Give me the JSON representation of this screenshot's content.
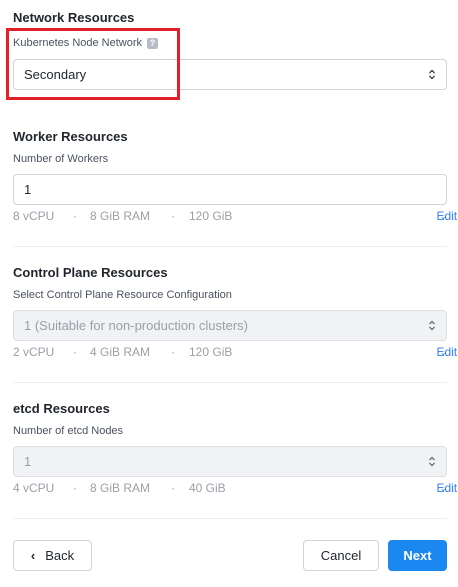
{
  "network": {
    "title": "Network Resources",
    "label": "Kubernetes Node Network",
    "help": "?",
    "value": "Secondary"
  },
  "worker": {
    "title": "Worker Resources",
    "label": "Number of Workers",
    "value": "1",
    "vcpu": "8 vCPU",
    "ram": "8 GiB RAM",
    "disk": "120 GiB",
    "edit": "Edit"
  },
  "control_plane": {
    "title": "Control Plane Resources",
    "label": "Select Control Plane Resource Configuration",
    "value": "1 (Suitable for non-production clusters)",
    "vcpu": "2 vCPU",
    "ram": "4 GiB RAM",
    "disk": "120 GiB",
    "edit": "Edit"
  },
  "etcd": {
    "title": "etcd Resources",
    "label": "Number of etcd Nodes",
    "value": "1",
    "vcpu": "4 vCPU",
    "ram": "8 GiB RAM",
    "disk": "40 GiB",
    "edit": "Edit"
  },
  "separator": "·",
  "footer": {
    "back": "Back",
    "cancel": "Cancel",
    "next": "Next"
  },
  "colors": {
    "accent": "#1b87f0",
    "highlight": "#e3202a",
    "link": "#2f7ee6"
  },
  "icons": {
    "select_arrows": "select-arrows-icon",
    "chevron_down": "chevron-down-icon",
    "chevron_left": "chevron-left-icon",
    "help": "help-icon"
  }
}
